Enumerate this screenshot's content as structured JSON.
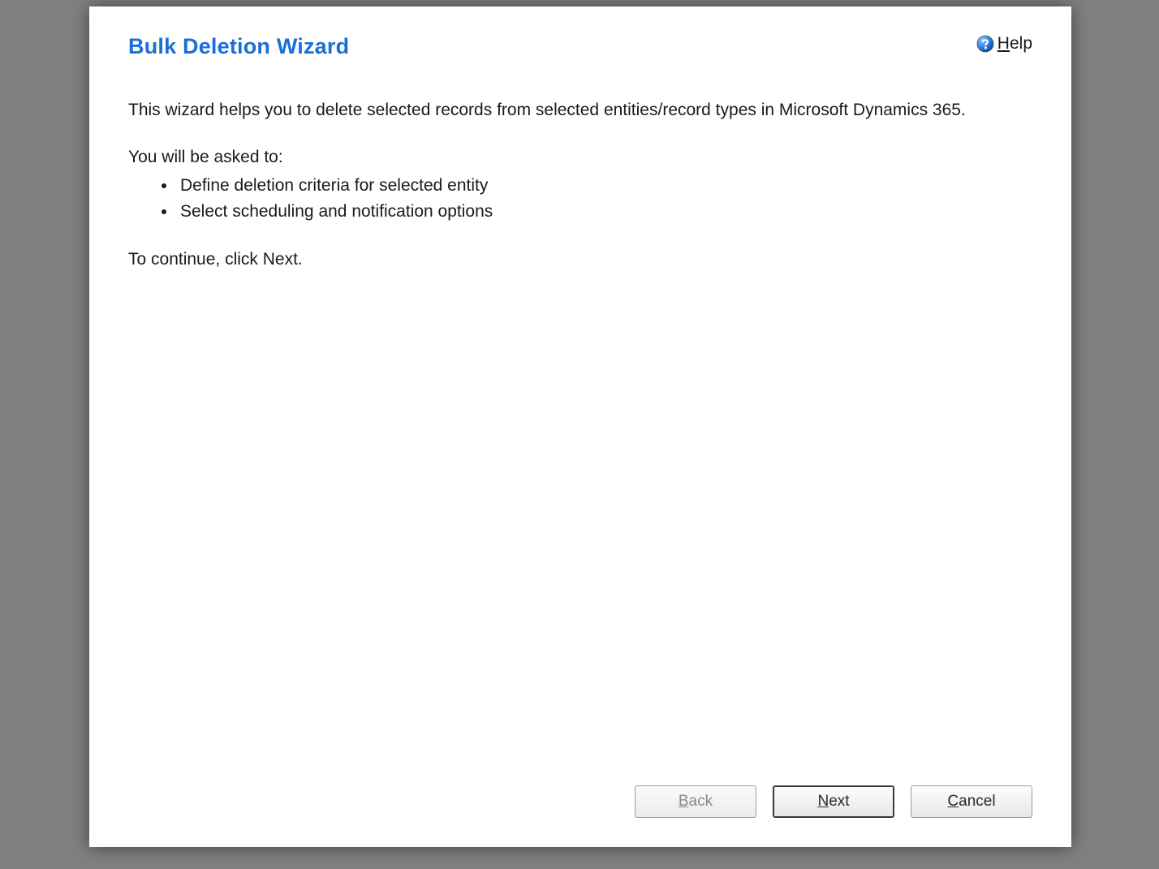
{
  "header": {
    "title": "Bulk Deletion Wizard",
    "help_label": "Help",
    "help_accesskey": "H"
  },
  "body": {
    "intro": "This wizard helps you to delete selected records from selected entities/record types in Microsoft Dynamics 365.",
    "prompt": "You will be asked to:",
    "bullets": [
      "Define deletion criteria for selected entity",
      "Select scheduling and notification options"
    ],
    "continue_text": "To continue, click Next."
  },
  "buttons": {
    "back": {
      "label": "Back",
      "accesskey": "B",
      "enabled": false
    },
    "next": {
      "label": "Next",
      "accesskey": "N",
      "enabled": true,
      "primary": true
    },
    "cancel": {
      "label": "Cancel",
      "accesskey": "C",
      "enabled": true
    }
  }
}
